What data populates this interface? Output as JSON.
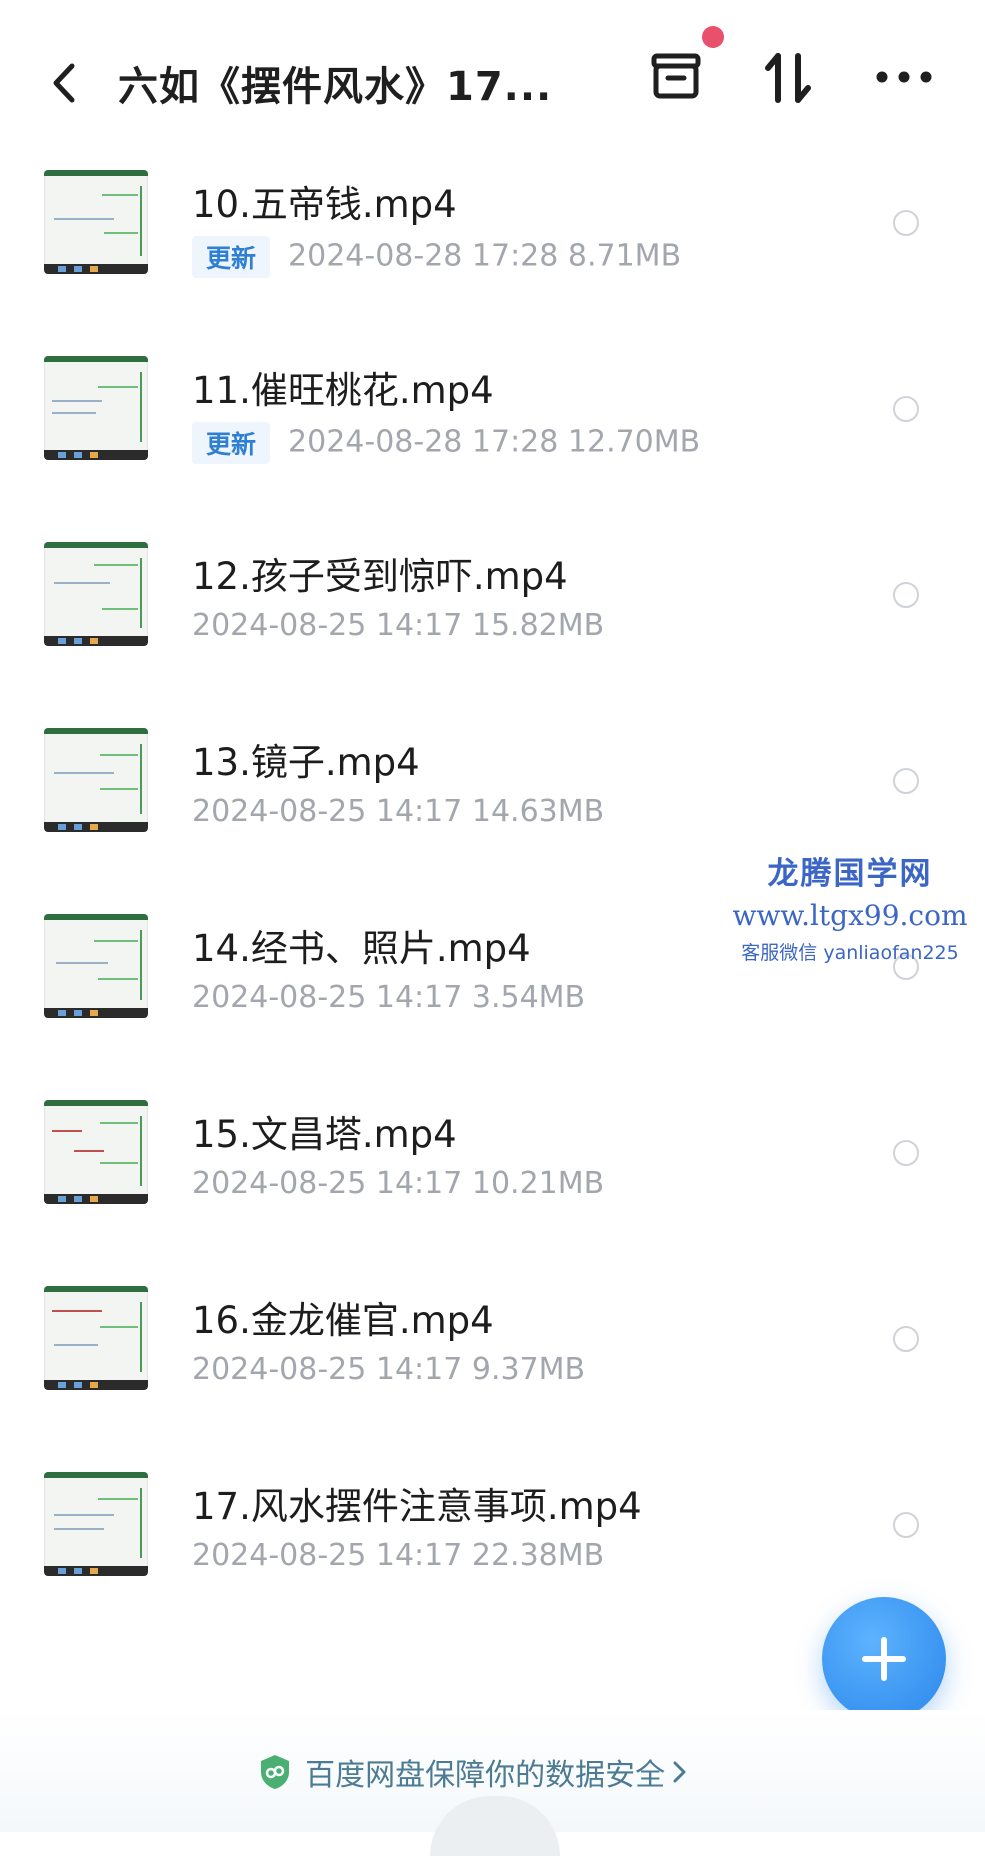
{
  "header": {
    "title": "六如《摆件风水》17..."
  },
  "files": [
    {
      "name": "10.五帝钱.mp4",
      "badge": "更新",
      "meta": "2024-08-28  17:28   8.71MB"
    },
    {
      "name": "11.催旺桃花.mp4",
      "badge": "更新",
      "meta": "2024-08-28  17:28   12.70MB"
    },
    {
      "name": "12.孩子受到惊吓.mp4",
      "badge": "",
      "meta": "2024-08-25  14:17   15.82MB"
    },
    {
      "name": "13.镜子.mp4",
      "badge": "",
      "meta": "2024-08-25  14:17   14.63MB"
    },
    {
      "name": "14.经书、照片.mp4",
      "badge": "",
      "meta": "2024-08-25  14:17   3.54MB"
    },
    {
      "name": "15.文昌塔.mp4",
      "badge": "",
      "meta": "2024-08-25  14:17   10.21MB"
    },
    {
      "name": "16.金龙催官.mp4",
      "badge": "",
      "meta": "2024-08-25  14:17   9.37MB"
    },
    {
      "name": "17.风水摆件注意事项.mp4",
      "badge": "",
      "meta": "2024-08-25  14:17   22.38MB"
    }
  ],
  "watermark": {
    "line1": "龙腾国学网",
    "line2": "www.ltgx99.com",
    "line3": "客服微信 yanliaofan225"
  },
  "footer": {
    "text": "百度网盘保障你的数据安全"
  },
  "colors": {
    "accent": "#2a86ea",
    "badge_text": "#2f7fd2",
    "meta_text": "#a3a7ad",
    "notification_dot": "#e8506c"
  }
}
